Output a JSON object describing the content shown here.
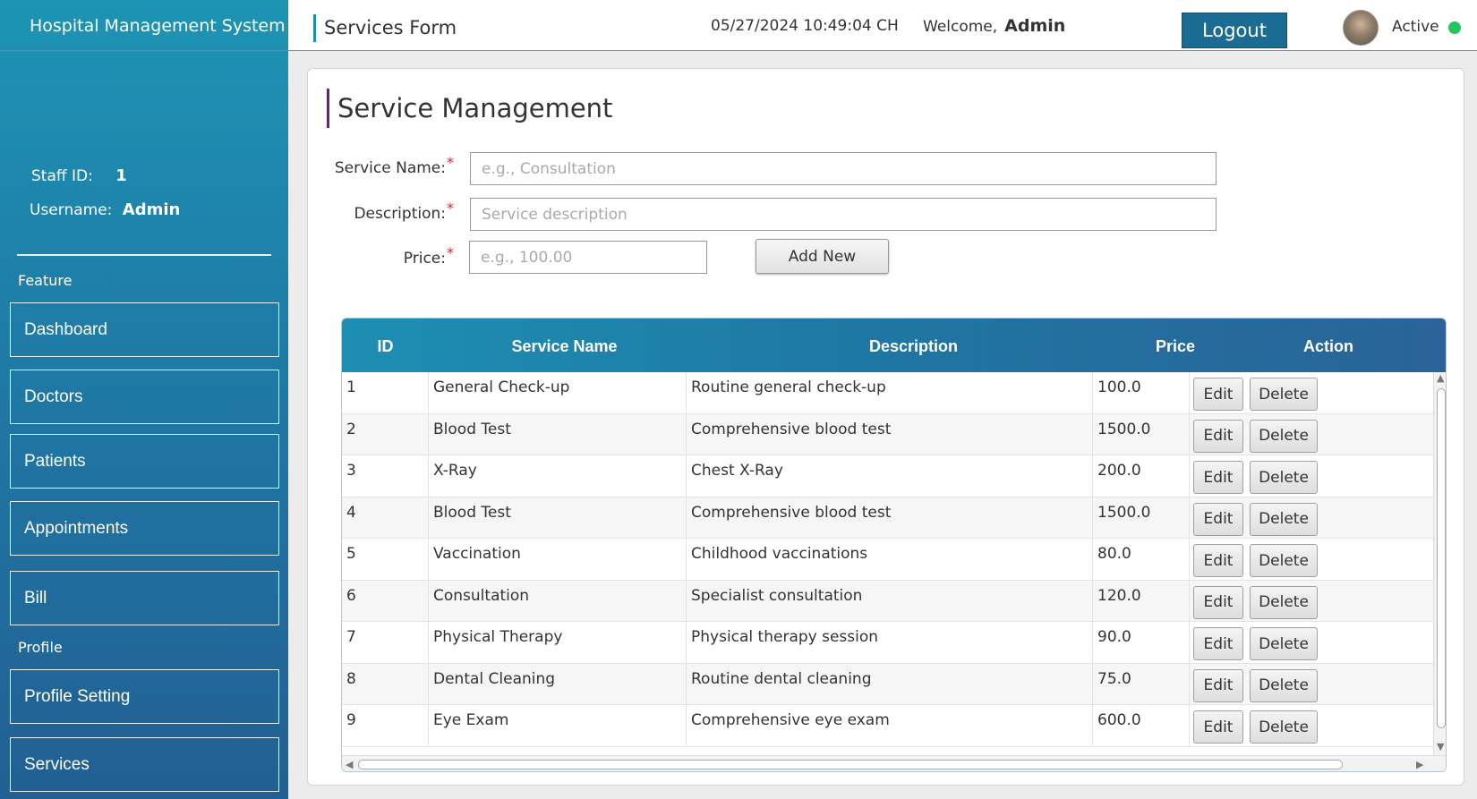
{
  "app": {
    "title": "Hospital Management System"
  },
  "sidebar": {
    "staff_id_label": "Staff ID:",
    "staff_id_value": "1",
    "username_label": "Username:",
    "username_value": "Admin",
    "feature_section": "Feature",
    "profile_section": "Profile",
    "items": [
      {
        "label": "Dashboard"
      },
      {
        "label": "Doctors"
      },
      {
        "label": "Patients"
      },
      {
        "label": "Appointments"
      },
      {
        "label": "Bill"
      },
      {
        "label": "Profile Setting"
      },
      {
        "label": "Services"
      }
    ]
  },
  "header": {
    "form_title": "Services Form",
    "datetime": "05/27/2024 10:49:04 CH",
    "welcome_label": "Welcome,",
    "welcome_user": "Admin",
    "logout_label": "Logout",
    "status_label": "Active",
    "status_color": "#22c55e",
    "accent_color": "#1a6c93"
  },
  "form": {
    "title": "Service Management",
    "service_name_label": "Service Name:",
    "service_name_placeholder": "e.g., Consultation",
    "service_name_value": "",
    "description_label": "Description:",
    "description_placeholder": "Service description",
    "description_value": "",
    "price_label": "Price:",
    "price_placeholder": "e.g., 100.00",
    "price_value": "",
    "required_mark": "*",
    "add_button_label": "Add New"
  },
  "table": {
    "columns": [
      "ID",
      "Service Name",
      "Description",
      "Price",
      "Action"
    ],
    "edit_label": "Edit",
    "delete_label": "Delete",
    "rows": [
      {
        "id": "1",
        "name": "General Check-up",
        "description": "Routine general check-up",
        "price": "100.0"
      },
      {
        "id": "2",
        "name": "Blood Test",
        "description": "Comprehensive blood test",
        "price": "1500.0"
      },
      {
        "id": "3",
        "name": "X-Ray",
        "description": "Chest X-Ray",
        "price": "200.0"
      },
      {
        "id": "4",
        "name": "Blood Test",
        "description": "Comprehensive blood test",
        "price": "1500.0"
      },
      {
        "id": "5",
        "name": "Vaccination",
        "description": "Childhood vaccinations",
        "price": "80.0"
      },
      {
        "id": "6",
        "name": "Consultation",
        "description": "Specialist consultation",
        "price": "120.0"
      },
      {
        "id": "7",
        "name": "Physical Therapy",
        "description": "Physical therapy session",
        "price": "90.0"
      },
      {
        "id": "8",
        "name": "Dental Cleaning",
        "description": "Routine dental cleaning",
        "price": "75.0"
      },
      {
        "id": "9",
        "name": "Eye Exam",
        "description": "Comprehensive eye exam",
        "price": "600.0"
      }
    ]
  }
}
